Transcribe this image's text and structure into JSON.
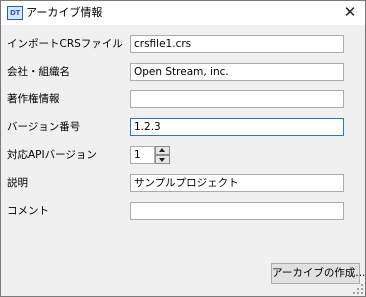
{
  "window": {
    "icon_text": "DT",
    "title": "アーカイブ情報",
    "close_symbol": "✕"
  },
  "form": {
    "import_crs_file": {
      "label": "インポートCRSファイル",
      "value": "crsfile1.crs"
    },
    "company_org": {
      "label": "会社・組織名",
      "value": "Open Stream, inc."
    },
    "copyright": {
      "label": "著作権情報",
      "value": ""
    },
    "version": {
      "label": "バージョン番号",
      "value": "1.2.3"
    },
    "api_version": {
      "label": "対応APIバージョン",
      "value": "1"
    },
    "description": {
      "label": "説明",
      "value": "サンプルプロジェクト"
    },
    "comment": {
      "label": "コメント",
      "value": ""
    }
  },
  "actions": {
    "create_archive_label": "アーカイブの作成..."
  },
  "colors": {
    "focus_border": "#2f73c9",
    "icon_accent": "#1f5fbf"
  }
}
